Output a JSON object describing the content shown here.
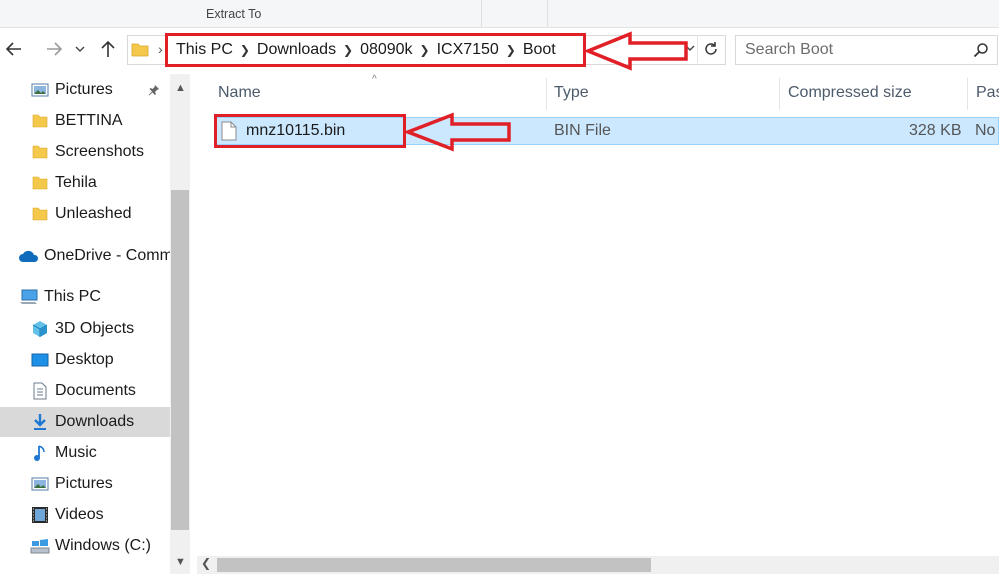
{
  "ribbon": {
    "extract_label": "Extract To"
  },
  "address": {
    "crumbs": [
      "This PC",
      "Downloads",
      "08090k",
      "ICX7150",
      "Boot"
    ]
  },
  "search": {
    "placeholder": "Search Boot"
  },
  "sidebar": {
    "items": [
      {
        "label": "Pictures",
        "icon": "pictures-icon",
        "pinned": true
      },
      {
        "label": "BETTINA",
        "icon": "folder-icon"
      },
      {
        "label": "Screenshots",
        "icon": "folder-icon"
      },
      {
        "label": "Tehila",
        "icon": "folder-icon"
      },
      {
        "label": "Unleashed",
        "icon": "folder-icon"
      },
      {
        "label": "OneDrive - Comm",
        "icon": "onedrive-icon"
      },
      {
        "label": "This PC",
        "icon": "this-pc-icon"
      },
      {
        "label": "3D Objects",
        "icon": "3d-objects-icon"
      },
      {
        "label": "Desktop",
        "icon": "desktop-icon"
      },
      {
        "label": "Documents",
        "icon": "documents-icon"
      },
      {
        "label": "Downloads",
        "icon": "downloads-icon",
        "selected": true
      },
      {
        "label": "Music",
        "icon": "music-icon"
      },
      {
        "label": "Pictures",
        "icon": "pictures-icon"
      },
      {
        "label": "Videos",
        "icon": "videos-icon"
      },
      {
        "label": "Windows (C:)",
        "icon": "drive-icon"
      }
    ]
  },
  "columns": [
    "Name",
    "Type",
    "Compressed size",
    "Pas"
  ],
  "files": [
    {
      "name": "mnz10115.bin",
      "type": "BIN File",
      "compressed_size": "328 KB",
      "password": "No"
    }
  ],
  "colors": {
    "annotation_red": "#e01f26",
    "selection_bg": "#cce8ff",
    "selection_border": "#99d1ff"
  }
}
